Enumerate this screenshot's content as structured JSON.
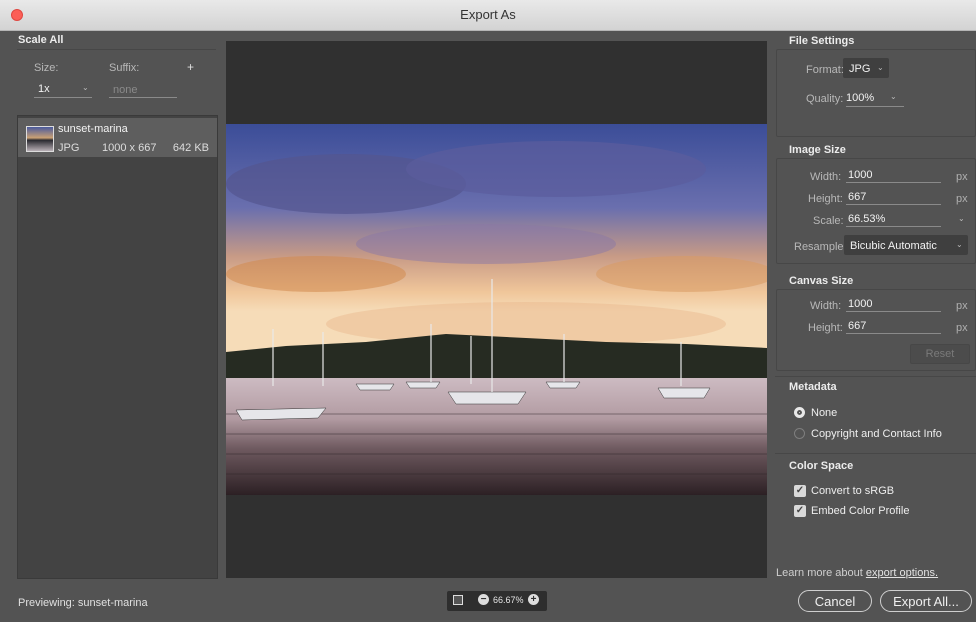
{
  "window": {
    "title": "Export As"
  },
  "scale_all": {
    "heading": "Scale All",
    "size_label": "Size:",
    "suffix_label": "Suffix:",
    "add_symbol": "+",
    "size_value": "1x",
    "suffix_placeholder": "none"
  },
  "asset": {
    "name": "sunset-marina",
    "format": "JPG",
    "dimensions": "1000 x 667",
    "filesize": "642 KB"
  },
  "file_settings": {
    "heading": "File Settings",
    "format_label": "Format:",
    "format_value": "JPG",
    "quality_label": "Quality:",
    "quality_value": "100%"
  },
  "image_size": {
    "heading": "Image Size",
    "width_label": "Width:",
    "width_value": "1000",
    "width_unit": "px",
    "height_label": "Height:",
    "height_value": "667",
    "height_unit": "px",
    "scale_label": "Scale:",
    "scale_value": "66.53%",
    "resample_label": "Resample:",
    "resample_value": "Bicubic Automatic"
  },
  "canvas_size": {
    "heading": "Canvas Size",
    "width_label": "Width:",
    "width_value": "1000",
    "width_unit": "px",
    "height_label": "Height:",
    "height_value": "667",
    "height_unit": "px",
    "reset_label": "Reset"
  },
  "metadata": {
    "heading": "Metadata",
    "option_none": "None",
    "option_copyright": "Copyright and Contact Info",
    "selected": "None"
  },
  "color_space": {
    "heading": "Color Space",
    "convert_label": "Convert to sRGB",
    "convert_checked": true,
    "embed_label": "Embed Color Profile",
    "embed_checked": true
  },
  "learn_more": {
    "prefix": "Learn more about ",
    "link": "export options."
  },
  "footer": {
    "previewing_label": "Previewing: sunset-marina",
    "zoom": "66.67%",
    "cancel_label": "Cancel",
    "export_label": "Export All..."
  },
  "colors": {
    "accent_close": "#fc5f57",
    "panel_bg": "#535353",
    "preview_bg": "#303030"
  }
}
